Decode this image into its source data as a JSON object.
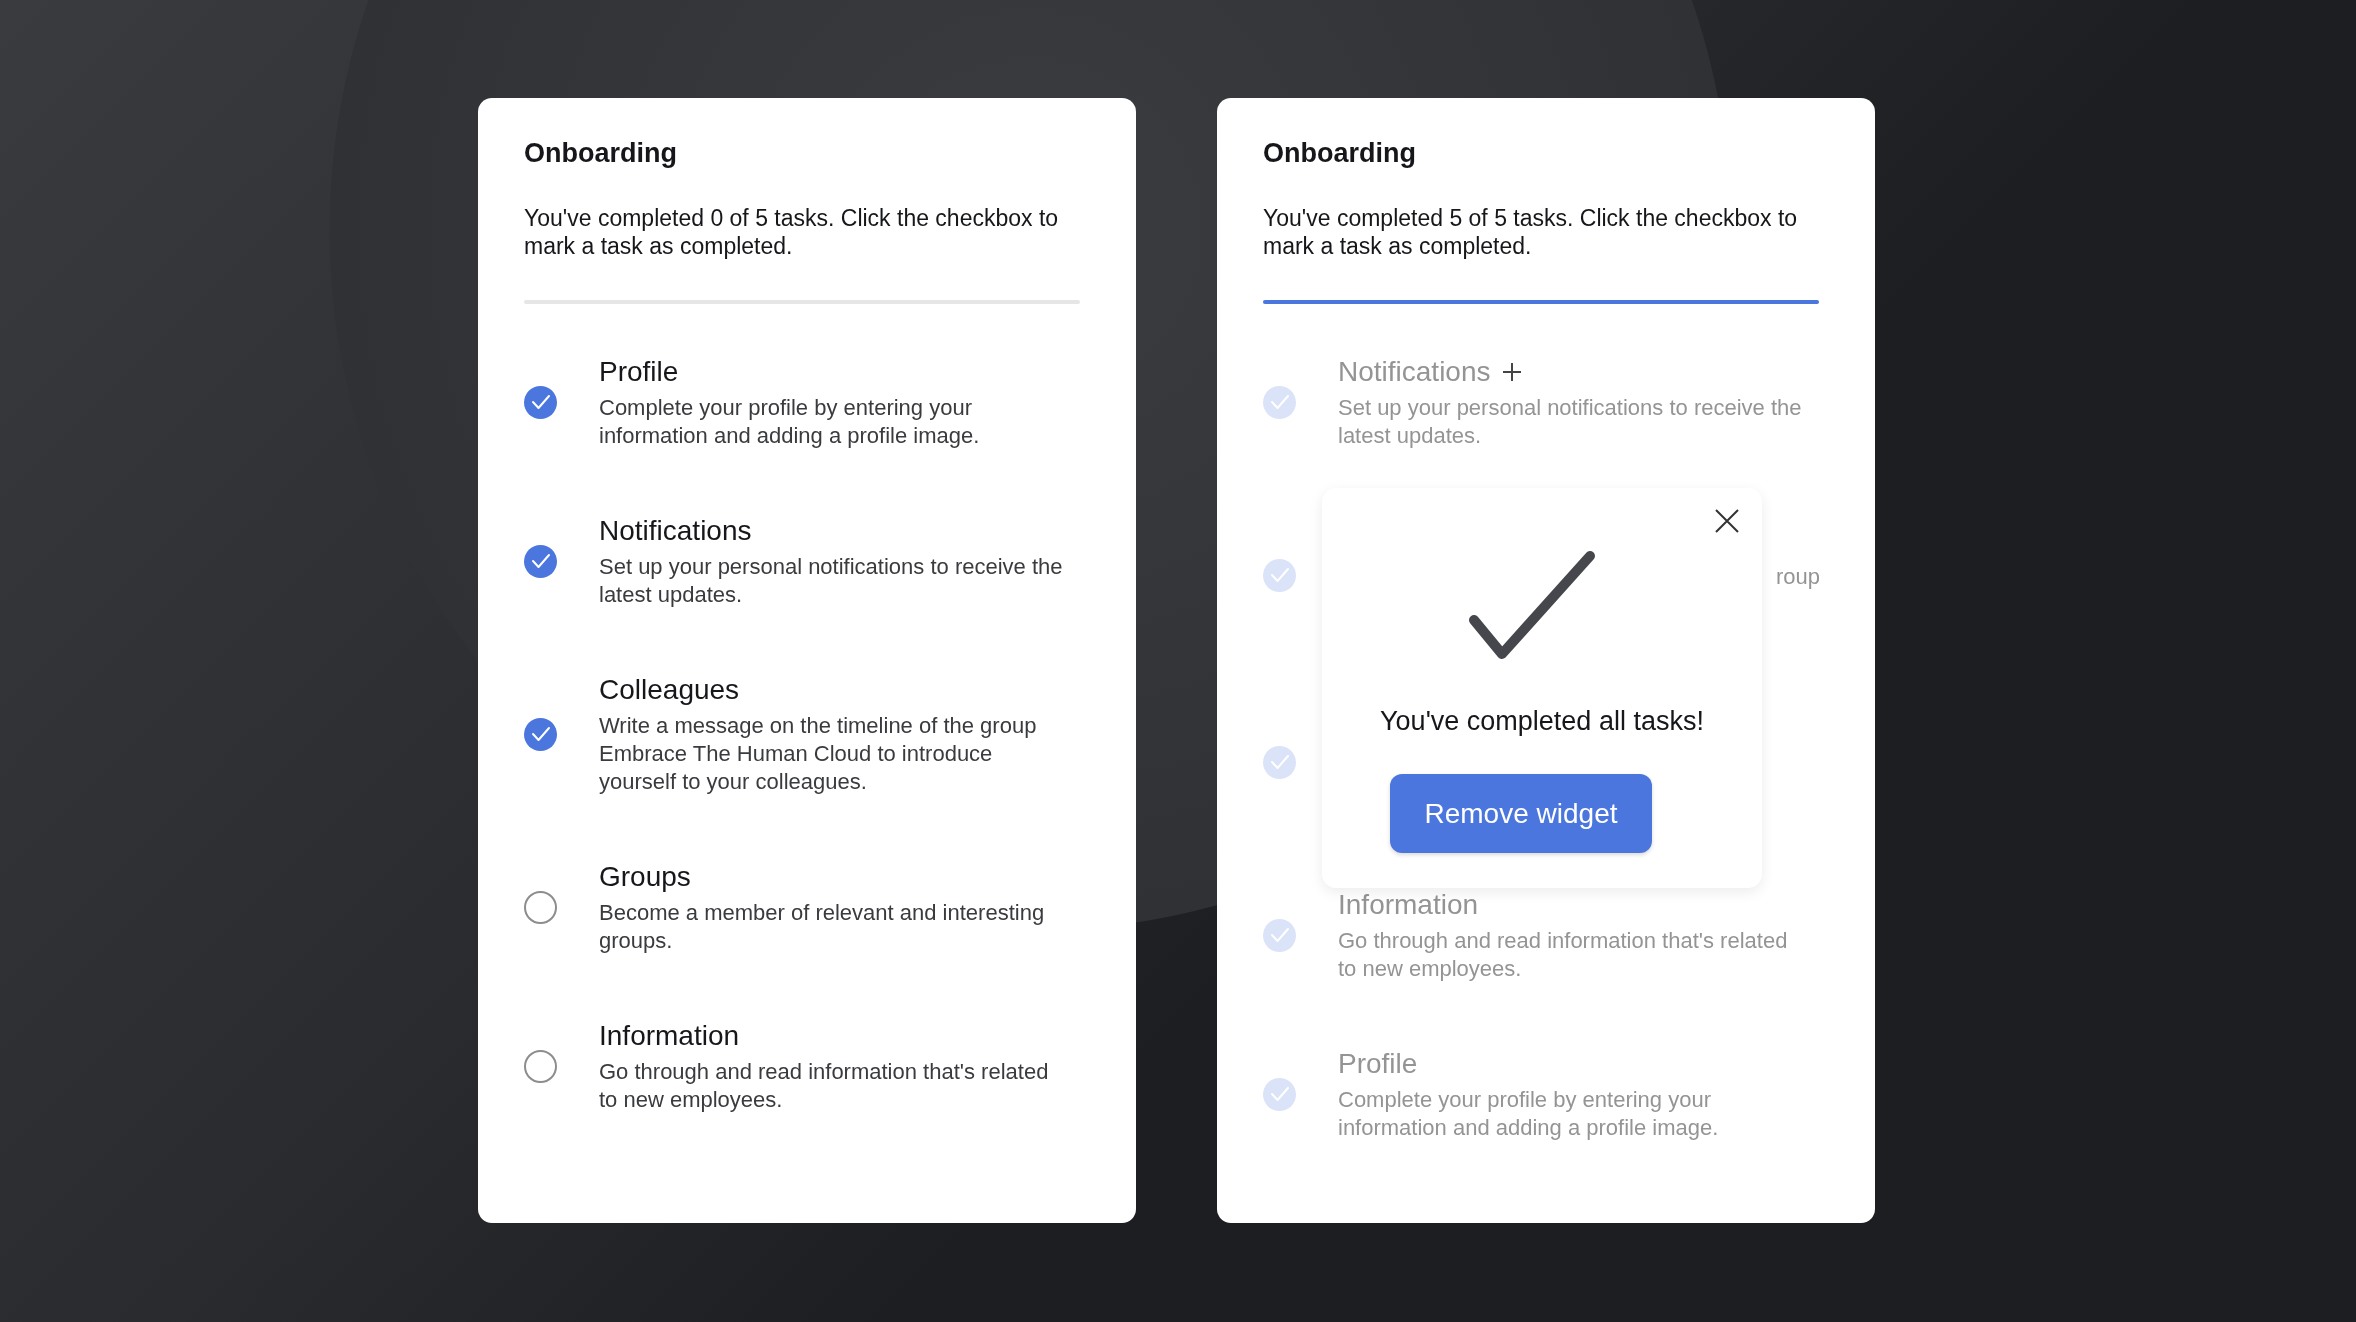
{
  "cards": [
    {
      "title": "Onboarding",
      "summary": "You've completed 0 of 5 tasks. Click the checkbox to mark a task as completed.",
      "dimmed": false,
      "progress": {
        "level": 0
      },
      "tasks": [
        {
          "title": "Profile",
          "description": "Complete your profile by entering your information and adding a profile image.",
          "checked": true
        },
        {
          "title": "Notifications",
          "description": "Set up your personal notifications to receive the latest updates.",
          "checked": true
        },
        {
          "title": "Colleagues",
          "description": "Write a message on the timeline of the group Embrace The Human Cloud to introduce yourself to your colleagues.",
          "checked": true
        },
        {
          "title": "Groups",
          "description": "Become a member of relevant and interesting groups.",
          "checked": false
        },
        {
          "title": "Information",
          "description": "Go through and read information that's related to new employees.",
          "checked": false
        }
      ]
    },
    {
      "title": "Onboarding",
      "summary": "You've completed 5 of 5 tasks. Click the checkbox to mark a task as completed.",
      "dimmed": true,
      "progress": {
        "level": 1
      },
      "tasks": [
        {
          "title": "Notifications",
          "description": "Set up your personal notifications to receive the latest updates.",
          "checked": true,
          "plus_icon": true
        },
        {
          "description": "roup",
          "checked": true
        },
        {
          "checked": true
        },
        {
          "title": "Information",
          "description": "Go through and read information that's related to new employees.",
          "checked": true
        },
        {
          "title": "Profile",
          "description": "Complete your profile by entering your information and adding a profile image.",
          "checked": true
        }
      ],
      "dialog": {
        "message": "You've completed all tasks!",
        "button": "Remove widget"
      }
    }
  ]
}
